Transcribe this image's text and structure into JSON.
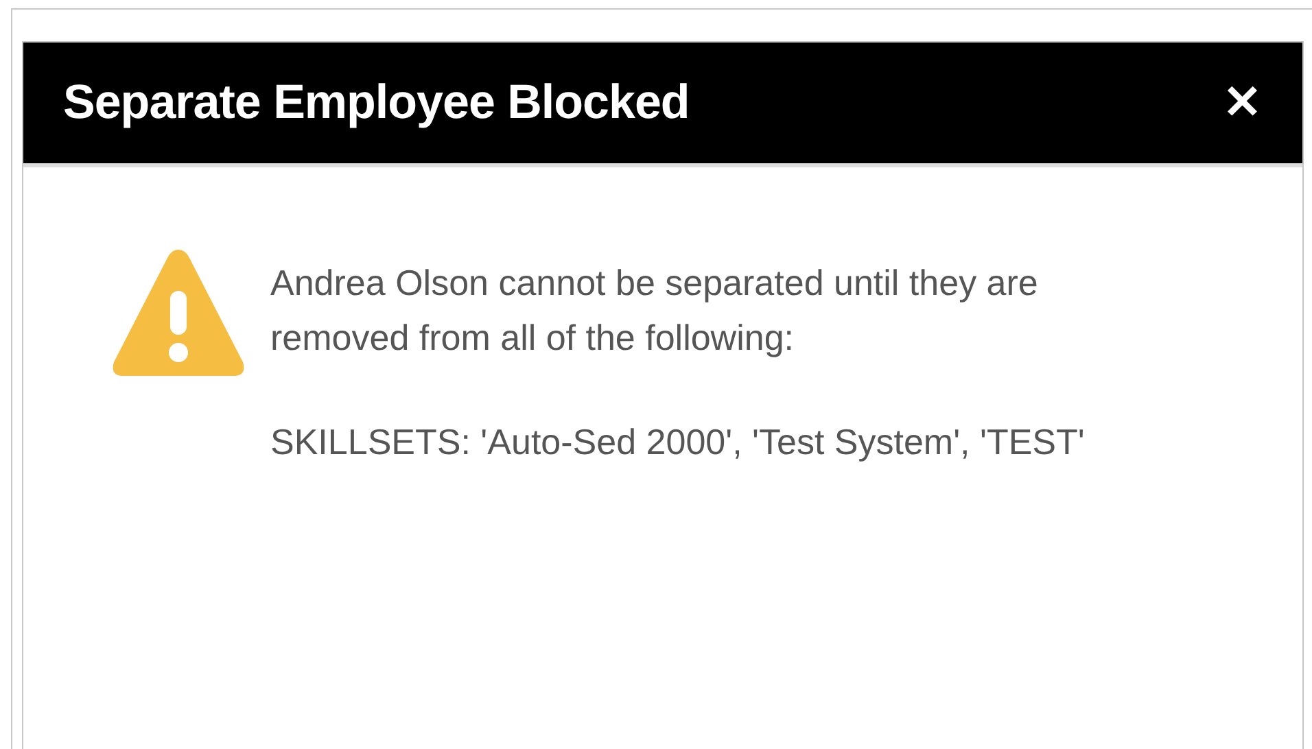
{
  "dialog": {
    "title": "Separate Employee Blocked",
    "close": "✕",
    "message": "Andrea Olson cannot be separated until they are removed from all of the following:",
    "details": "SKILLSETS: 'Auto-Sed 2000', 'Test System', 'TEST'"
  }
}
